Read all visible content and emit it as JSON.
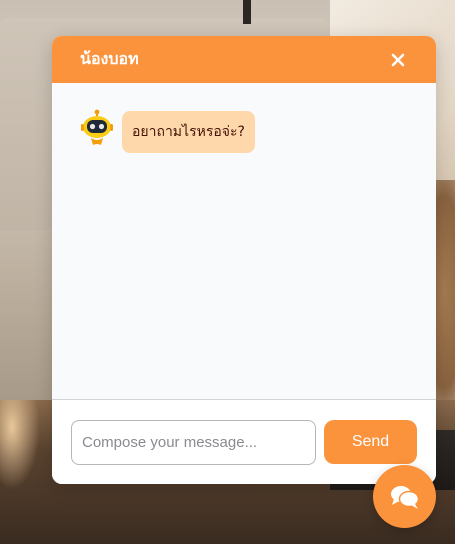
{
  "header": {
    "title": "น้องบอท",
    "close_icon": "close-icon"
  },
  "messages": [
    {
      "sender": "bot",
      "avatar_icon": "robot-icon",
      "text": "อยาถามไรหรอจ่ะ?"
    }
  ],
  "composer": {
    "placeholder": "Compose your message...",
    "value": "",
    "send_label": "Send"
  },
  "launcher": {
    "icon": "chat-bubbles-icon"
  },
  "colors": {
    "accent": "#fb923c",
    "bubble": "#fed7aa",
    "bubble_text": "#431407",
    "chat_bg": "#f8fafc"
  }
}
